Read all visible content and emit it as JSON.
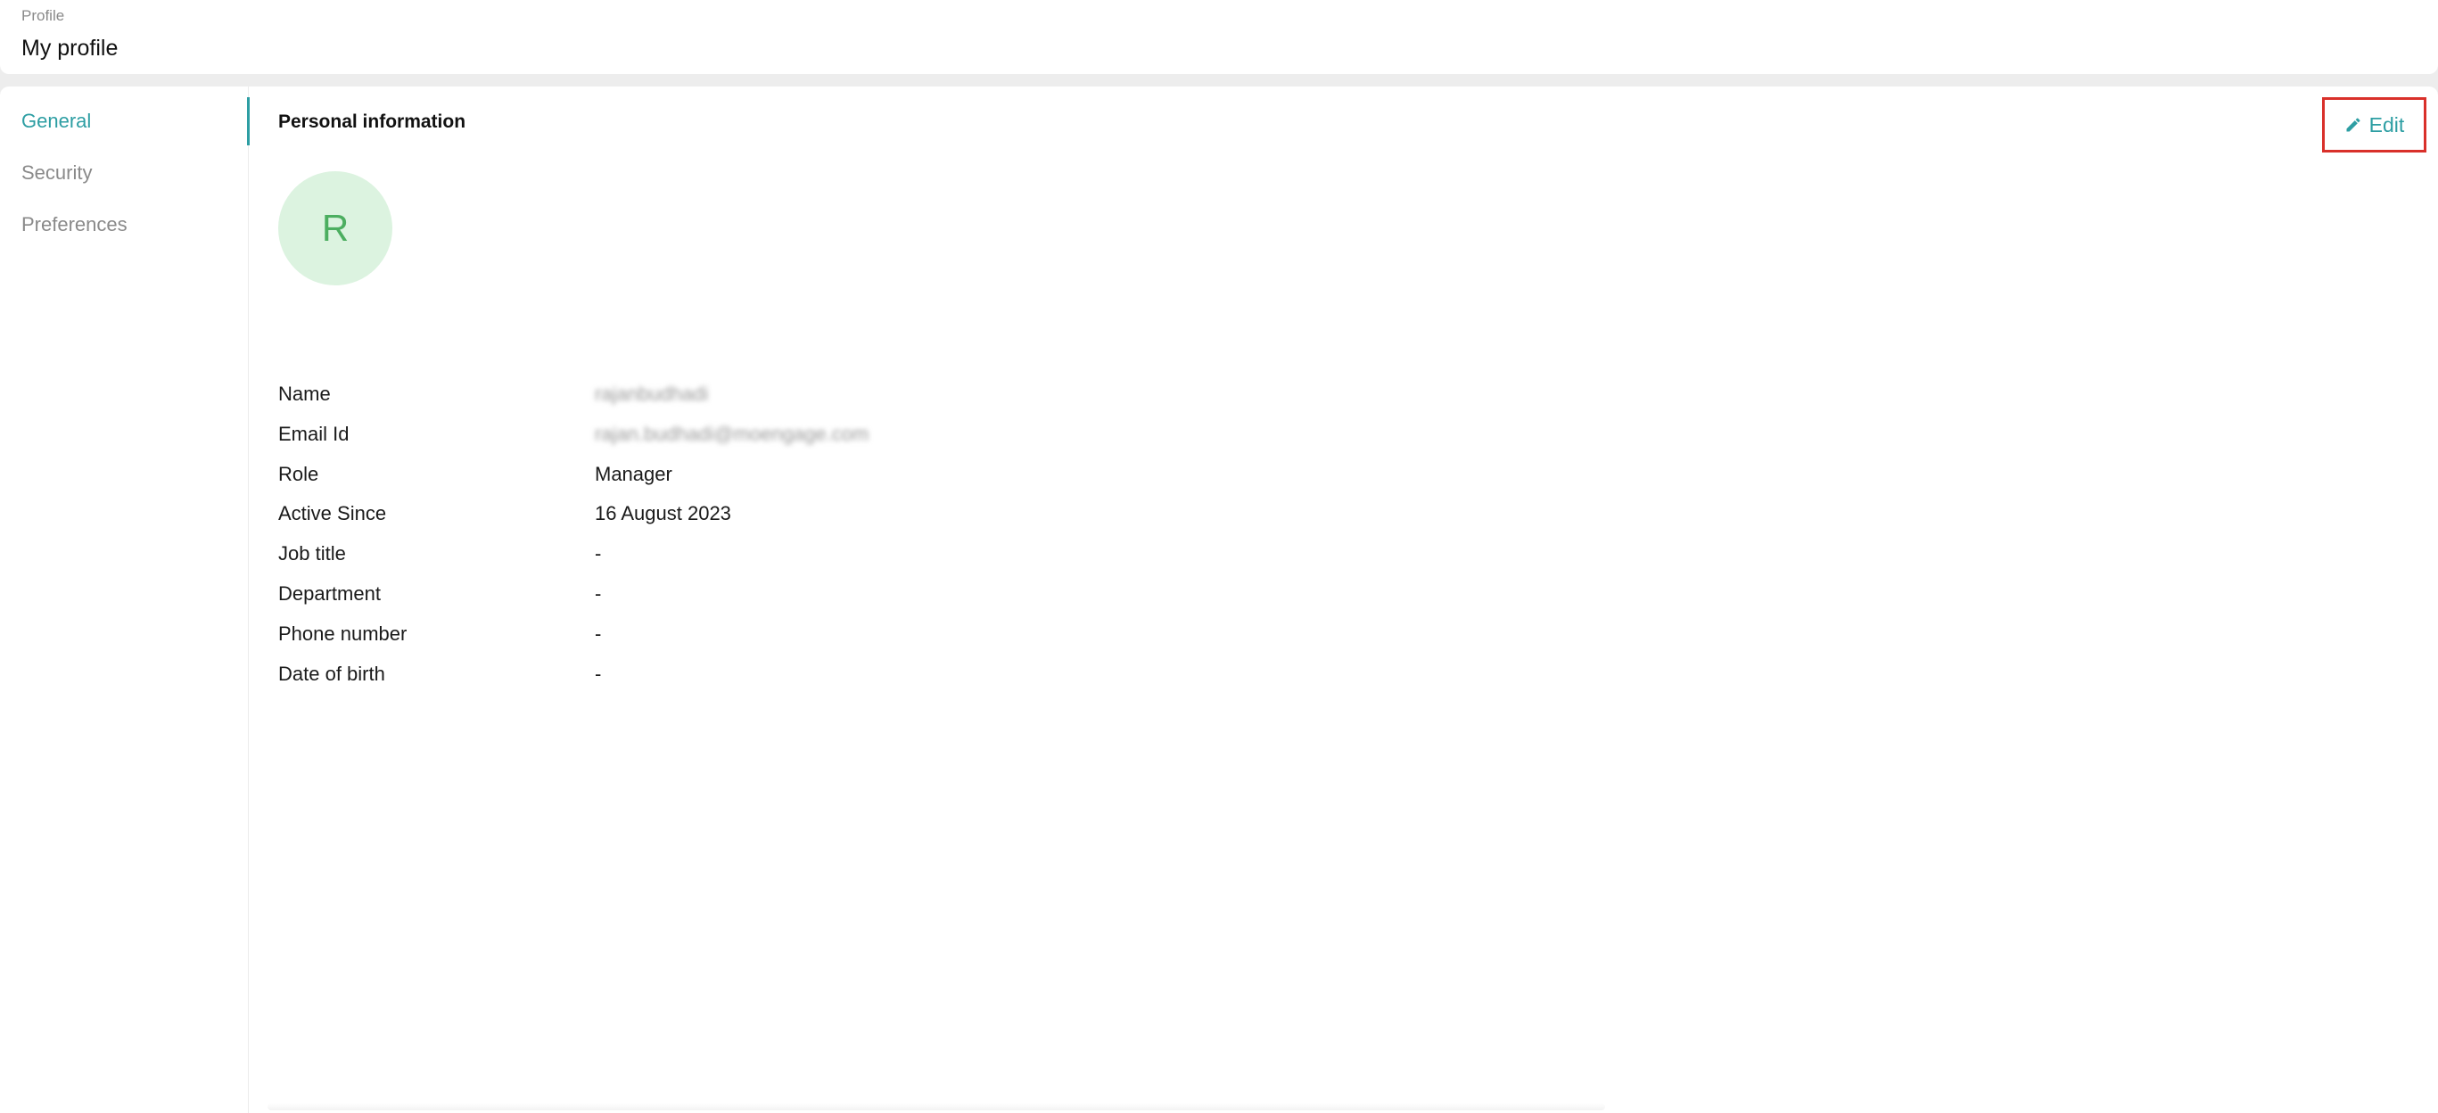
{
  "header": {
    "breadcrumb": "Profile",
    "title": "My profile"
  },
  "sidebar": {
    "items": [
      {
        "label": "General",
        "active": true
      },
      {
        "label": "Security",
        "active": false
      },
      {
        "label": "Preferences",
        "active": false
      }
    ]
  },
  "main": {
    "section_title": "Personal information",
    "edit_label": "Edit",
    "edit_icon": "pencil-icon",
    "avatar_initial": "R",
    "fields": [
      {
        "label": "Name",
        "value": "rajanbudhadi"
      },
      {
        "label": "Email Id",
        "value": "rajan.budhadi@moengage.com"
      },
      {
        "label": "Role",
        "value": "Manager"
      },
      {
        "label": "Active Since",
        "value": "16 August 2023"
      },
      {
        "label": "Job title",
        "value": "-"
      },
      {
        "label": "Department",
        "value": "-"
      },
      {
        "label": "Phone number",
        "value": "-"
      },
      {
        "label": "Date of birth",
        "value": "-"
      }
    ]
  },
  "colors": {
    "accent": "#2d9ea3",
    "avatar_bg": "#dcf3e0",
    "avatar_text": "#4cae60",
    "highlight_border": "#d9302a"
  }
}
